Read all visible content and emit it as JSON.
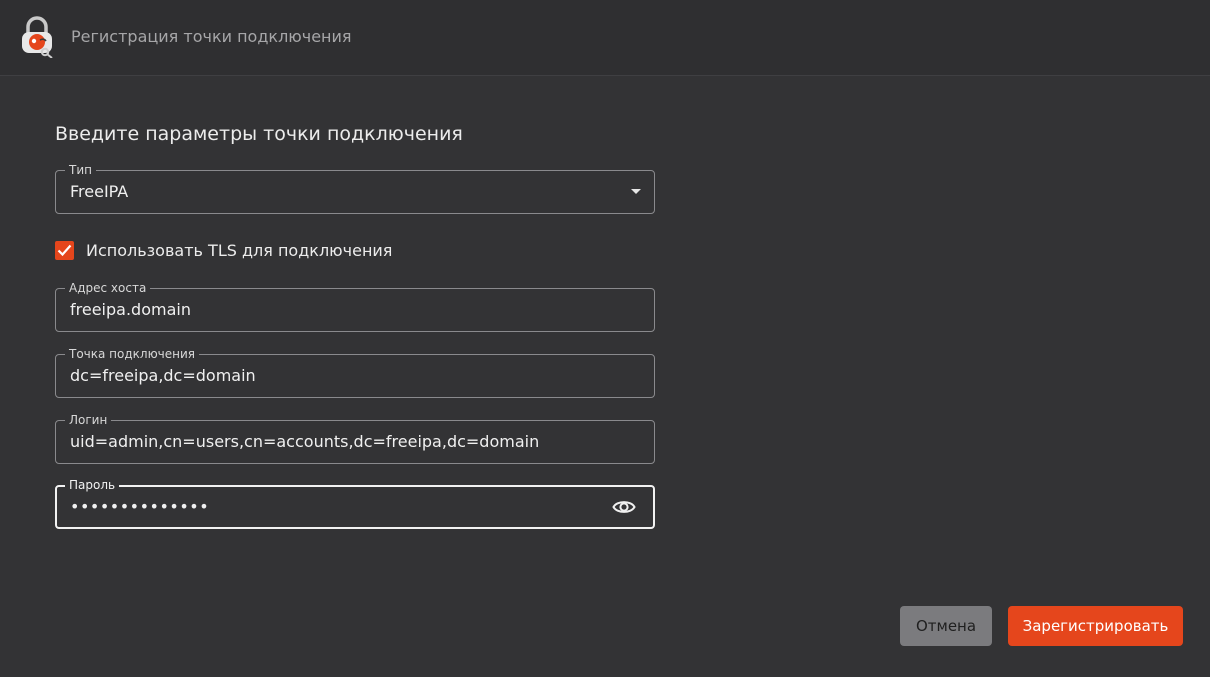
{
  "window": {
    "title": "Регистрация точки подключения"
  },
  "form": {
    "heading": "Введите параметры точки подключения",
    "type_field": {
      "label": "Тип",
      "value": "FreeIPA"
    },
    "tls_checkbox": {
      "label": "Использовать TLS для подключения",
      "checked": true
    },
    "host_field": {
      "label": "Адрес хоста",
      "value": "freeipa.domain"
    },
    "base_dn_field": {
      "label": "Точка подключения",
      "value": "dc=freeipa,dc=domain"
    },
    "login_field": {
      "label": "Логин",
      "value": "uid=admin,cn=users,cn=accounts,dc=freeipa,dc=domain"
    },
    "password_field": {
      "label": "Пароль",
      "value": "••••••••••••••"
    }
  },
  "actions": {
    "cancel_label": "Отмена",
    "register_label": "Зарегистрировать"
  },
  "colors": {
    "accent": "#e5461c",
    "background": "#333335",
    "titlebar": "#2f2f31",
    "cancel_button": "#7b7b7e"
  },
  "icons": {
    "app": "padlock-key-icon",
    "dropdown": "dropdown-arrow-icon",
    "password_toggle": "eye-icon",
    "checkbox": "checkmark-icon"
  }
}
